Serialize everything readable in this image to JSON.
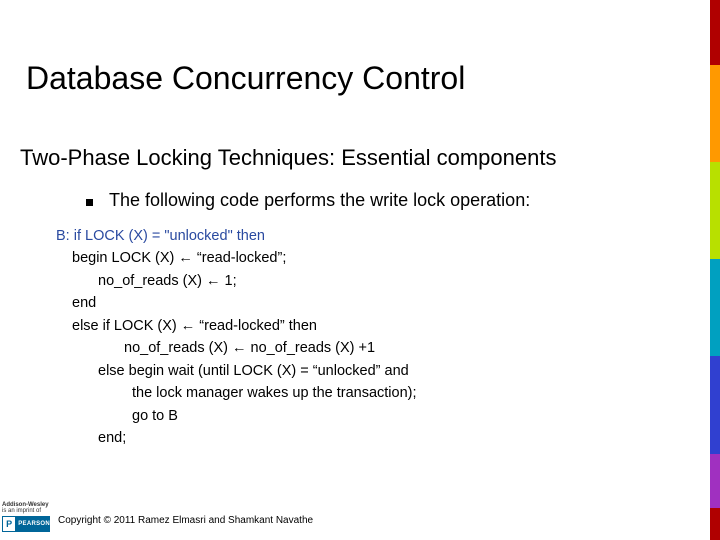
{
  "title": "Database Concurrency Control",
  "subtitle": "Two-Phase Locking Techniques: Essential components",
  "bullet": "The following code performs the write lock operation:",
  "code": {
    "l1": "B: if LOCK (X) = \"unlocked\" then",
    "l2": "begin LOCK (X) ← “read-locked”;",
    "l3": "no_of_reads (X) ← 1;",
    "l4": "end",
    "l5": "else if LOCK (X) ← “read-locked” then",
    "l6": "no_of_reads (X) ← no_of_reads (X) +1",
    "l7": "else begin wait (until LOCK (X) = “unlocked” and",
    "l8": "the lock manager wakes up the transaction);",
    "l9": "go to B",
    "l10": "end;"
  },
  "footer": "Copyright © 2011 Ramez Elmasri and Shamkant Navathe",
  "logo": {
    "top": "Addison-Wesley",
    "sub": "is an imprint of",
    "brand": "PEARSON",
    "letter": "P"
  },
  "stripe_colors": [
    "#b00000",
    "#ff9900",
    "#b8e000",
    "#00a0c0",
    "#3040d0",
    "#a030c0",
    "#b00000"
  ]
}
